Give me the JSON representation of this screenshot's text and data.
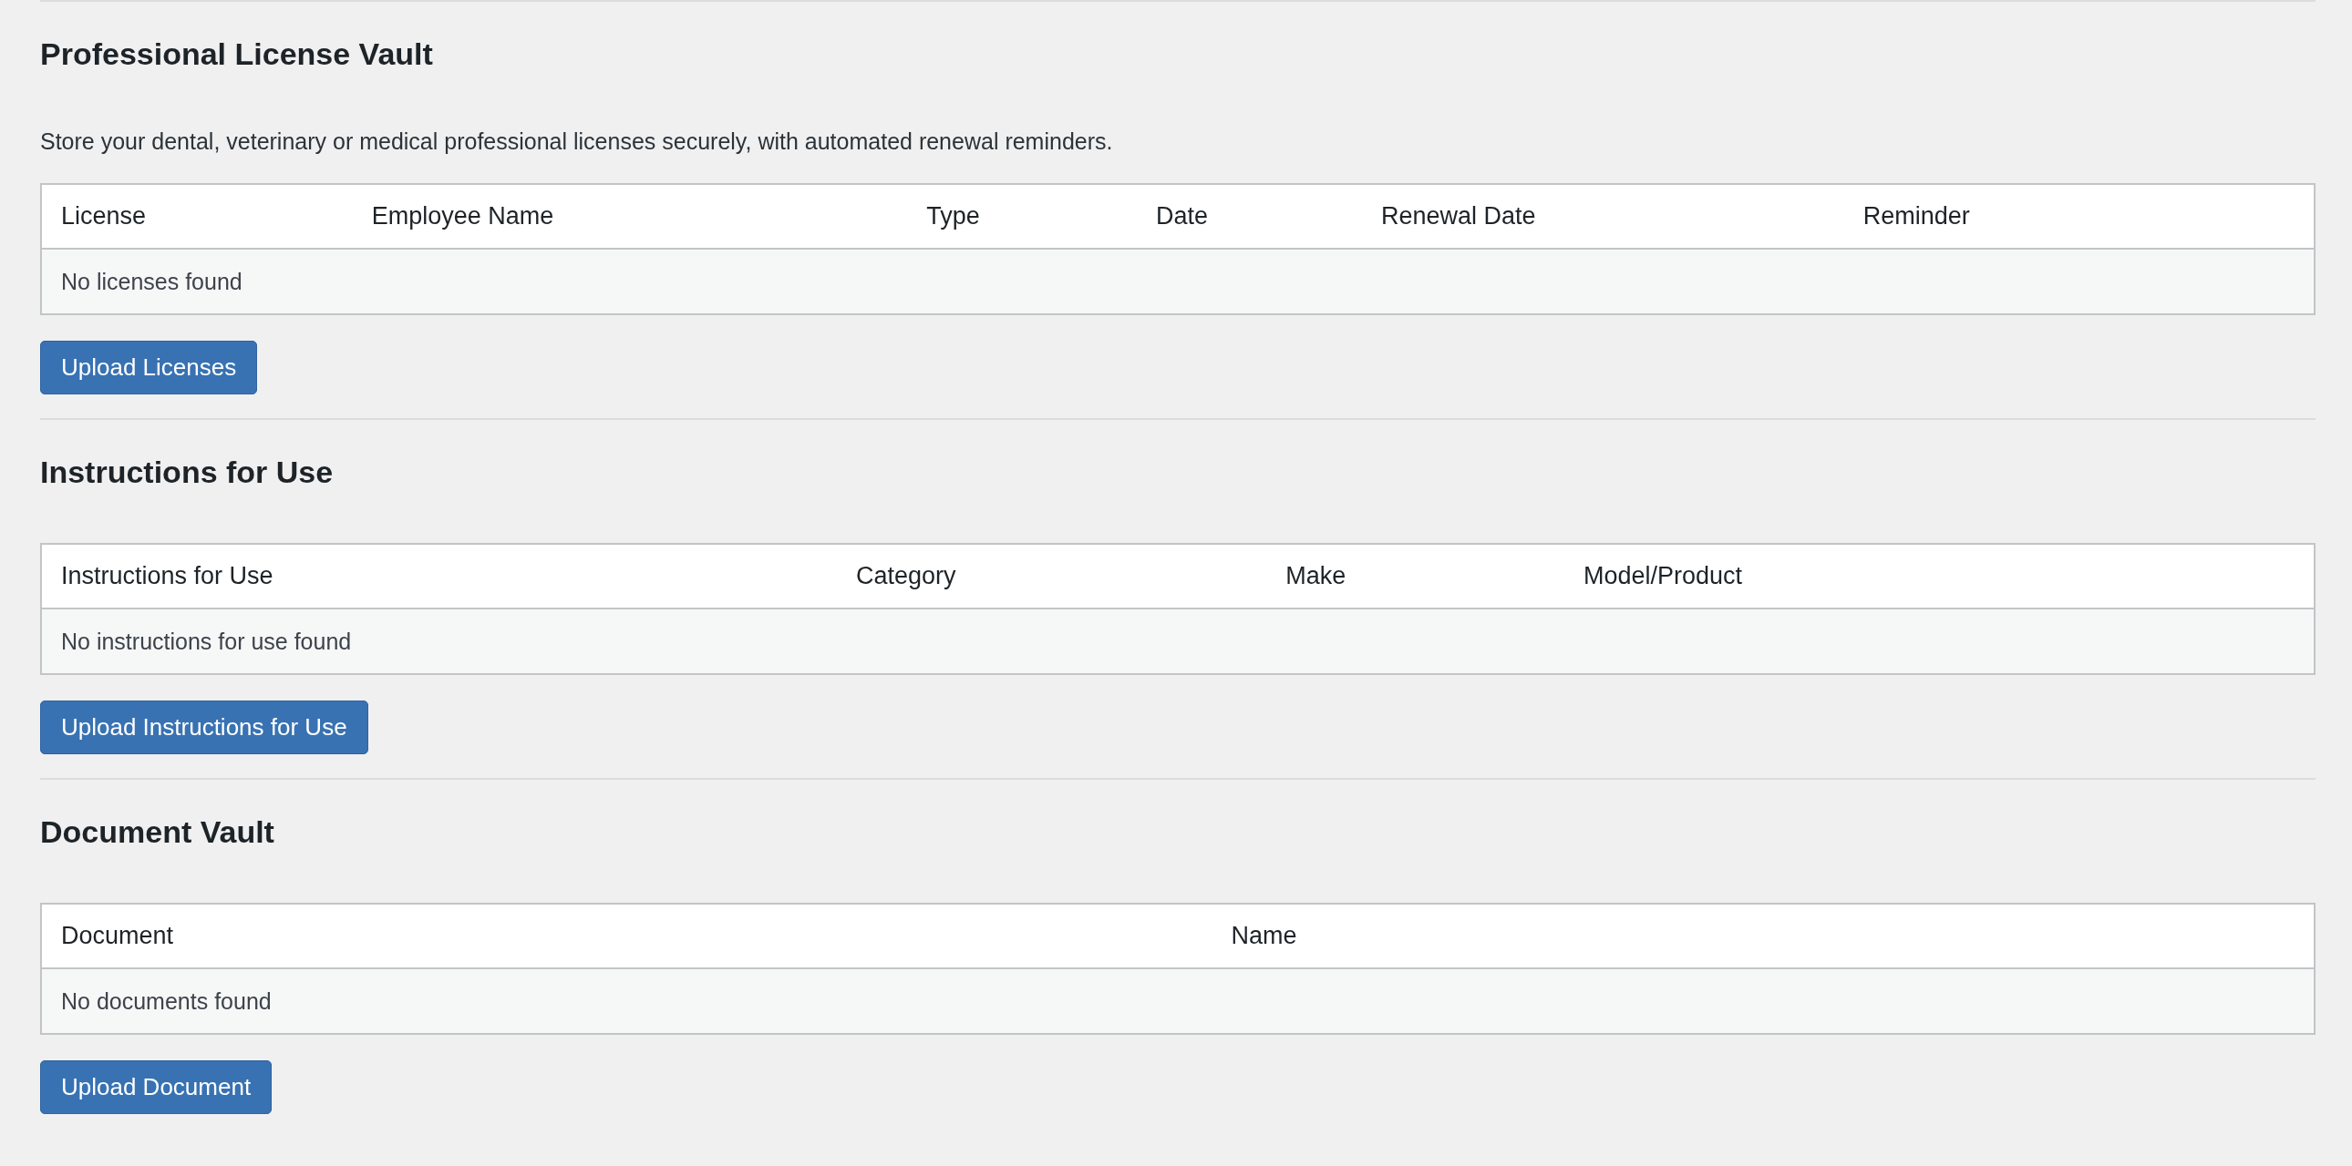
{
  "sections": [
    {
      "title": "Professional License Vault",
      "description": "Store your dental, veterinary or medical professional licenses securely, with automated renewal reminders.",
      "table": {
        "columns": [
          "License",
          "Employee Name",
          "Type",
          "Date",
          "Renewal Date",
          "Reminder"
        ],
        "empty_message": "No licenses found"
      },
      "button": "Upload Licenses"
    },
    {
      "title": "Instructions for Use",
      "table": {
        "columns": [
          "Instructions for Use",
          "Category",
          "Make",
          "Model/Product"
        ],
        "empty_message": "No instructions for use found"
      },
      "button": "Upload Instructions for Use"
    },
    {
      "title": "Document Vault",
      "table": {
        "columns": [
          "Document",
          "Name"
        ],
        "empty_message": "No documents found"
      },
      "button": "Upload Document"
    }
  ]
}
